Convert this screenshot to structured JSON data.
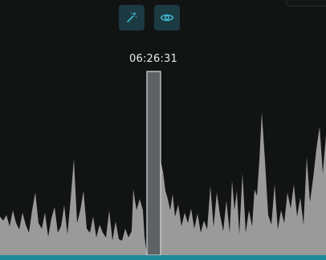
{
  "toolbar": {
    "magic_wand_icon": "magic-wand-icon",
    "eye_icon": "eye-icon",
    "icon_color": "#3fb6cc",
    "button_color": "#1c3a42"
  },
  "playhead": {
    "time_label": "06:26:31"
  },
  "colors": {
    "background": "#121414",
    "waveform": "#9a9a9a",
    "selection_fill": "#6d7072",
    "selection_border": "#d8dada",
    "timeline_bar": "#1f8a99"
  }
}
